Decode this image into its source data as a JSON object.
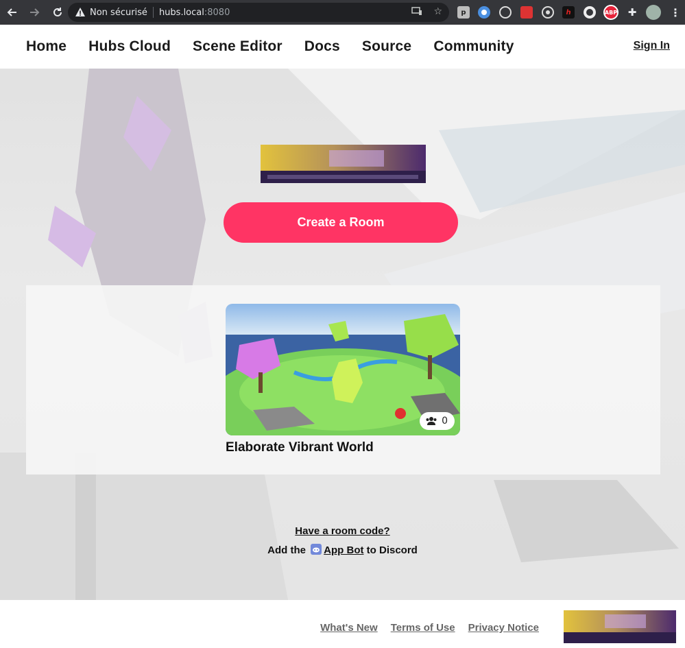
{
  "browser": {
    "security_label": "Non sécurisé",
    "url_host": "hubs.local",
    "url_port": ":8080",
    "extensions": [
      "p",
      "h",
      "ABP"
    ]
  },
  "header": {
    "nav": [
      "Home",
      "Hubs Cloud",
      "Scene Editor",
      "Docs",
      "Source",
      "Community"
    ],
    "sign_in": "Sign In"
  },
  "hero": {
    "create_room_label": "Create a Room"
  },
  "rooms": [
    {
      "name": "Elaborate Vibrant World",
      "member_count": "0"
    }
  ],
  "links": {
    "room_code": "Have a room code?",
    "discord_prefix": "Add the",
    "discord_link": "App Bot",
    "discord_suffix": "to Discord"
  },
  "footer": {
    "links": [
      "What's New",
      "Terms of Use",
      "Privacy Notice"
    ]
  },
  "colors": {
    "accent": "#ff3464",
    "chrome": "#35363a",
    "discord": "#7289da"
  }
}
